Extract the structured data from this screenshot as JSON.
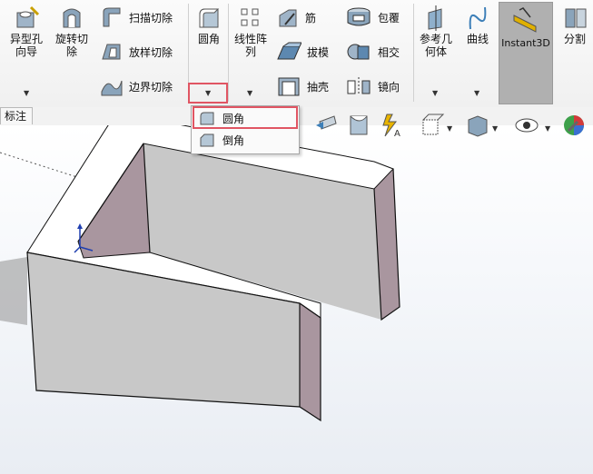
{
  "ribbon": {
    "hole_wizard": "异型孔\n向导",
    "revolve_cut": "旋转切\n除",
    "sweep_cut": "扫描切除",
    "loft_cut": "放样切除",
    "boundary_cut": "边界切除",
    "fillet": "圆角",
    "linear_pattern": "线性阵\n列",
    "rib": "筋",
    "draft": "拔模",
    "shell": "抽壳",
    "wrap": "包覆",
    "intersect": "相交",
    "mirror": "镜向",
    "reference_geometry": "参考几\n何体",
    "curves": "曲线",
    "instant3d": "Instant3D",
    "split": "分割"
  },
  "tabs": {
    "annotation": "标注"
  },
  "dropdown": {
    "items": [
      {
        "label": "圆角"
      },
      {
        "label": "倒角"
      }
    ]
  },
  "colors": {
    "highlight": "#e05563",
    "face_top": "#ffffff",
    "face_front": "#c8c8c8",
    "face_side": "#a9969f"
  }
}
